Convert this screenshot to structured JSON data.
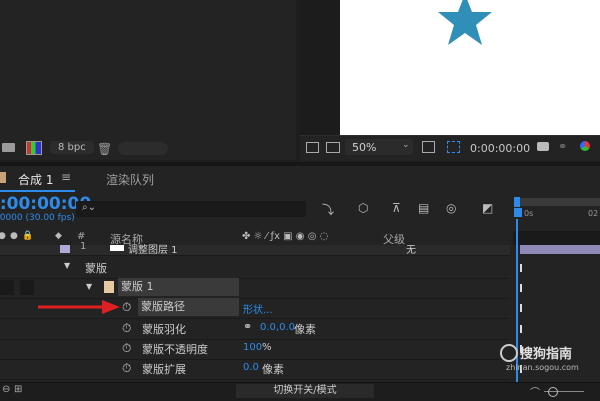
{
  "project": {
    "bpc": "8 bpc"
  },
  "viewer": {
    "zoom": "50%",
    "timecode": "0:00:00:00"
  },
  "tabs": {
    "comp": "合成 1",
    "render": "渲染队列"
  },
  "timeline": {
    "timecode": "0:00:00:00",
    "fps": "00000 (30.00 fps)",
    "search_placeholder": "",
    "headers": {
      "num": "#",
      "source": "源名称",
      "parent": "父级"
    },
    "ruler": {
      "r1": "0s",
      "r2": "02"
    },
    "layer1": {
      "num": "1",
      "name": "调整图层 1",
      "parent": "无"
    },
    "masks_group": "蒙版",
    "mask1": "蒙版 1",
    "props": [
      {
        "name": "蒙版路径",
        "value": "形状..."
      },
      {
        "name": "蒙版羽化",
        "value": "0.0,0.0",
        "unit": "像素"
      },
      {
        "name": "蒙版不透明度",
        "value": "100",
        "unit": "%"
      },
      {
        "name": "蒙版扩展",
        "value": "0.0",
        "unit": "像素"
      }
    ]
  },
  "bottom": {
    "toggle": "切换开关/模式"
  },
  "watermark": {
    "brand": "搜狗指南",
    "url": "zhinan.sogou.com"
  },
  "colors": {
    "accent": "#2d8ceb",
    "star": "#2f8fb8",
    "arrow": "#e02020"
  }
}
